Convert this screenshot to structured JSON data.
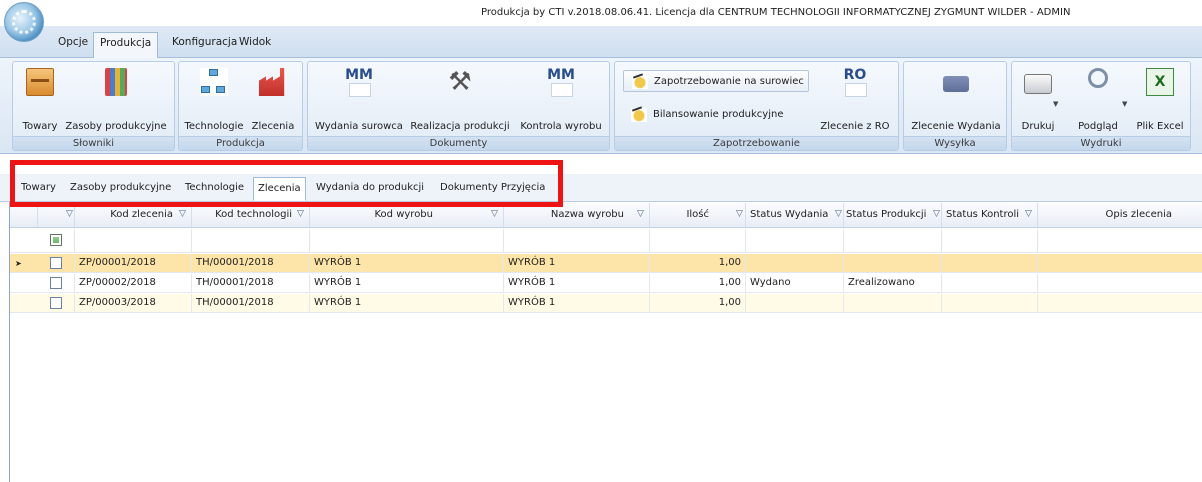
{
  "app": {
    "title": "Produkcja by CTI v.2018.08.06.41. Licencja dla CENTRUM TECHNOLOGII INFORMATYCZNEJ ZYGMUNT WILDER - ADMIN"
  },
  "menu": {
    "tabs": [
      {
        "label": "Opcje"
      },
      {
        "label": "Produkcja",
        "active": true
      },
      {
        "label": "Konfiguracja"
      },
      {
        "label": "Widok"
      }
    ]
  },
  "ribbon": {
    "groups": {
      "slowniki": {
        "label": "Słowniki",
        "buttons": [
          "Towary",
          "Zasoby produkcyjne"
        ]
      },
      "produkcja": {
        "label": "Produkcja",
        "buttons": [
          "Technologie",
          "Zlecenia"
        ]
      },
      "dokumenty": {
        "label": "Dokumenty",
        "buttons": [
          "Wydania surowca",
          "Realizacja produkcji",
          "Kontrola wyrobu"
        ],
        "icon_texts": [
          "MM",
          "MM"
        ]
      },
      "zapotrzebowanie": {
        "label": "Zapotrzebowanie",
        "small_buttons": [
          "Zapotrzebowanie na surowiec",
          "Bilansowanie produkcyjne"
        ],
        "buttons": [
          "Zlecenie z RO"
        ],
        "icon_text": "RO"
      },
      "wysylka": {
        "label": "Wysyłka",
        "buttons": [
          "Zlecenie Wydania"
        ]
      },
      "wydruki": {
        "label": "Wydruki",
        "buttons": [
          "Drukuj",
          "Podgląd",
          "Plik Excel"
        ]
      }
    }
  },
  "doc_tabs": [
    {
      "label": "Towary"
    },
    {
      "label": "Zasoby produkcyjne"
    },
    {
      "label": "Technologie"
    },
    {
      "label": "Zlecenia",
      "active": true
    },
    {
      "label": "Wydania do produkcji"
    },
    {
      "label": "Dokumenty Przyjęcia"
    }
  ],
  "grid": {
    "columns": [
      "Kod zlecenia",
      "Kod technologii",
      "Kod wyrobu",
      "Nazwa wyrobu",
      "Ilość",
      "Status Wydania",
      "Status Produkcji",
      "Status Kontroli",
      "Opis zlecenia"
    ],
    "rows": [
      {
        "kod_zlecenia": "ZP/00001/2018",
        "kod_technologii": "TH/00001/2018",
        "kod_wyrobu": "WYRÓB 1",
        "nazwa_wyrobu": "WYRÓB 1",
        "ilosc": "1,00",
        "status_wydania": "",
        "status_produkcji": "",
        "status_kontroli": "",
        "opis": "",
        "selected": true
      },
      {
        "kod_zlecenia": "ZP/00002/2018",
        "kod_technologii": "TH/00001/2018",
        "kod_wyrobu": "WYRÓB 1",
        "nazwa_wyrobu": "WYRÓB 1",
        "ilosc": "1,00",
        "status_wydania": "Wydano",
        "status_produkcji": "Zrealizowano",
        "status_kontroli": "",
        "opis": ""
      },
      {
        "kod_zlecenia": "ZP/00003/2018",
        "kod_technologii": "TH/00001/2018",
        "kod_wyrobu": "WYRÓB 1",
        "nazwa_wyrobu": "WYRÓB 1",
        "ilosc": "1,00",
        "status_wydania": "",
        "status_produkcji": "",
        "status_kontroli": "",
        "opis": ""
      }
    ]
  },
  "colors": {
    "selected_row": "#fde4a8",
    "alt_row": "#fffbe6",
    "highlight_box": "#ee1414"
  },
  "icons": [
    "app-orb-icon",
    "box-icon",
    "books-icon",
    "tree-icon",
    "factory-icon",
    "mm-document-icon",
    "hammer-icon",
    "coins-icon",
    "ro-document-icon",
    "truck-icon",
    "printer-icon",
    "magnifier-icon",
    "excel-icon",
    "filter-icon",
    "row-pointer-icon"
  ]
}
